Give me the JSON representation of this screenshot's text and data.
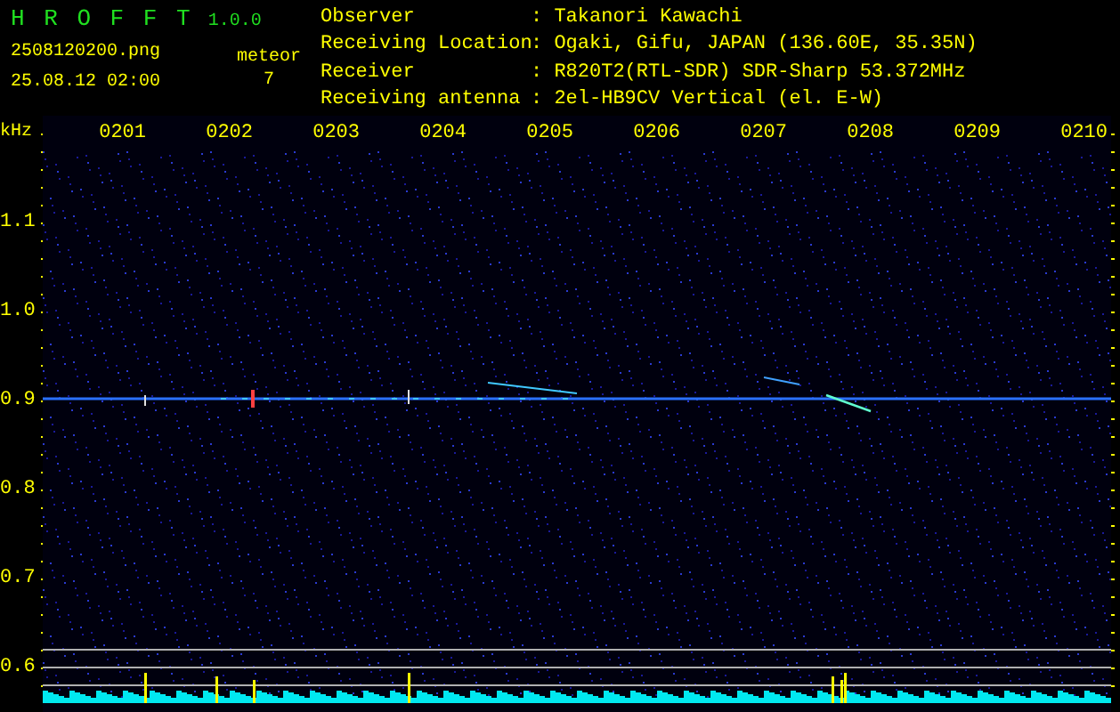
{
  "header": {
    "title": "H R O F F T",
    "version": "1.0.0",
    "file_name": "2508120200.png",
    "date_time": "25.08.12 02:00",
    "meteor_label": "meteor",
    "meteor_count": "7",
    "info": [
      {
        "label": "Observer",
        "value": ": Takanori Kawachi"
      },
      {
        "label": "Receiving Location",
        "value": ": Ogaki, Gifu, JAPAN (136.60E, 35.35N)"
      },
      {
        "label": "Receiver",
        "value": ": R820T2(RTL-SDR) SDR-Sharp 53.372MHz"
      },
      {
        "label": "Receiving antenna",
        "value": ": 2el-HB9CV Vertical (el. E-W)"
      }
    ]
  },
  "axis": {
    "unit": "kHz",
    "y_labels": [
      "1.1",
      "1.0",
      "0.9",
      "0.8",
      "0.7",
      "0.6"
    ],
    "x_labels": [
      "0201",
      "0202",
      "0203",
      "0204",
      "0205",
      "0206",
      "0207",
      "0208",
      "0209",
      "0210"
    ]
  }
}
